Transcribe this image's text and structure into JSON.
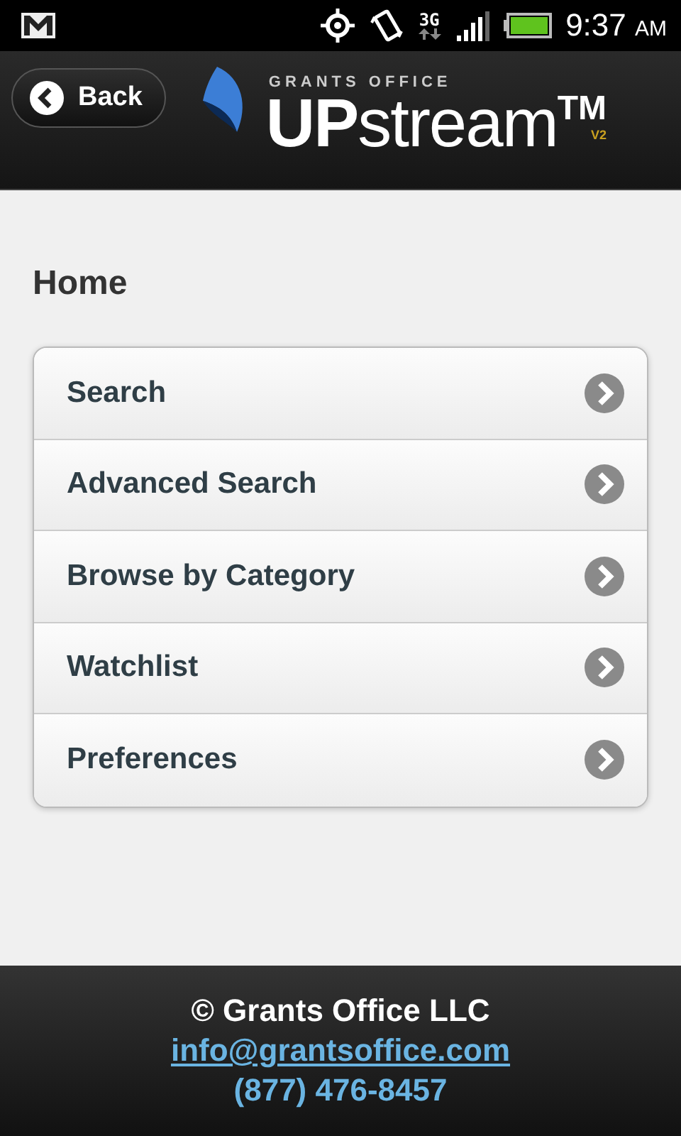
{
  "status_bar": {
    "time": "9:37",
    "ampm": "AM",
    "network": "3G"
  },
  "header": {
    "back_label": "Back",
    "logo": {
      "company": "GRANTS OFFICE",
      "name_bold": "UP",
      "name_rest": "stream",
      "trademark": "TM",
      "version": "V2"
    }
  },
  "page_title": "Home",
  "menu": [
    {
      "label": "Search"
    },
    {
      "label": "Advanced Search"
    },
    {
      "label": "Browse by Category"
    },
    {
      "label": "Watchlist"
    },
    {
      "label": "Preferences"
    }
  ],
  "footer": {
    "copyright": "© Grants Office LLC",
    "email": "info@grantsoffice.com",
    "phone": "(877) 476-8457"
  }
}
